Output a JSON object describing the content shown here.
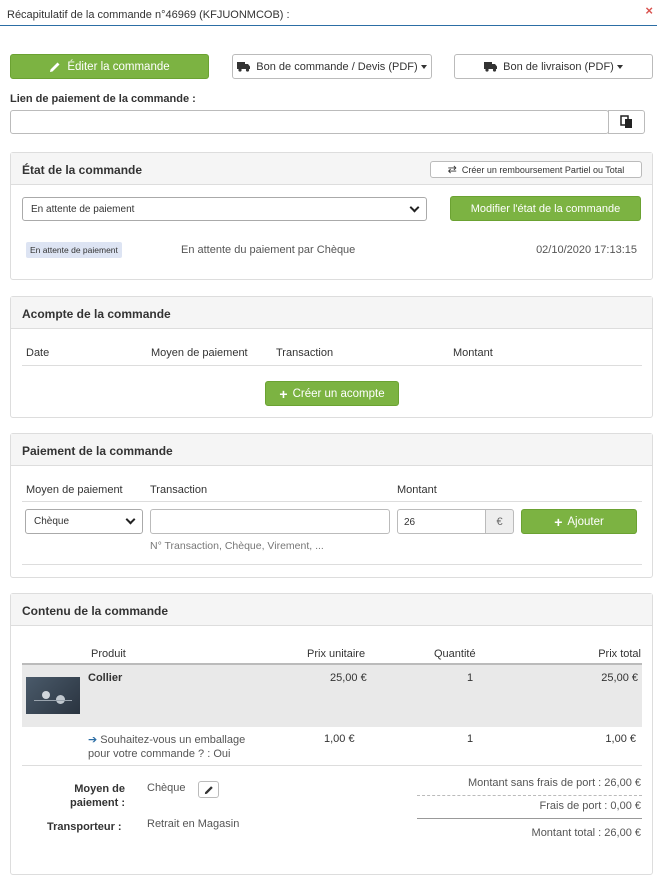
{
  "dialog": {
    "title": "Récapitulatif de la commande n°46969 (KFJUONMCOB) :",
    "close": "×"
  },
  "toolbar": {
    "edit": "Éditer la commande",
    "purchase_order": "Bon de commande / Devis (PDF)",
    "delivery_note": "Bon de livraison (PDF)"
  },
  "payment_link": {
    "label": "Lien de paiement de la commande :",
    "value": ""
  },
  "state": {
    "title": "État de la commande",
    "refund_button": "Créer un remboursement Partiel ou Total",
    "selected": "En attente de paiement",
    "modify_button": "Modifier l'état de la commande",
    "history": {
      "badge": "En attente de paiement",
      "message": "En attente du paiement par Chèque",
      "date": "02/10/2020 17:13:15"
    }
  },
  "deposit": {
    "title": "Acompte de la commande",
    "columns": [
      "Date",
      "Moyen de paiement",
      "Transaction",
      "Montant"
    ],
    "create_button": "Créer un acompte"
  },
  "payment": {
    "title": "Paiement de la commande",
    "columns": [
      "Moyen de paiement",
      "Transaction",
      "Montant"
    ],
    "method": "Chèque",
    "transaction": "",
    "amount": "26",
    "currency": "€",
    "add_button": "Ajouter",
    "help": "N° Transaction, Chèque, Virement, ..."
  },
  "content": {
    "title": "Contenu de la commande",
    "columns": [
      "Produit",
      "Prix unitaire",
      "Quantité",
      "Prix total"
    ],
    "rows": [
      {
        "product": "Collier",
        "unit_price": "25,00 €",
        "quantity": "1",
        "total": "25,00 €"
      },
      {
        "product_line1": "Souhaitez-vous un emballage",
        "product_line2": "pour votre commande ? : Oui",
        "unit_price": "1,00 €",
        "quantity": "1",
        "total": "1,00 €"
      }
    ],
    "summary": {
      "payment_label_1": "Moyen de",
      "payment_label_2": "paiement :",
      "payment_value": "Chèque",
      "carrier_label": "Transporteur :",
      "carrier_value": "Retrait en Magasin",
      "subtotal": "Montant sans frais de port : 26,00 €",
      "shipping": "Frais de port : 0,00 €",
      "total": "Montant total : 26,00 €"
    }
  },
  "colors": {
    "green": "#7cb342",
    "header_line": "#2c6ea5",
    "badge_bg": "#dde4f3"
  }
}
